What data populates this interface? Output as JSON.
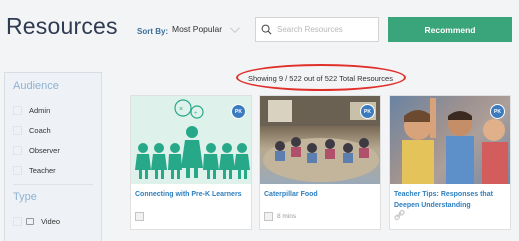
{
  "header": {
    "title": "Resources",
    "sort_label": "Sort By:",
    "sort_value": "Most Popular",
    "search_placeholder": "Search Resources",
    "recommend_label": "Recommend"
  },
  "sidebar": {
    "audience_heading": "Audience",
    "audience_items": [
      "Admin",
      "Coach",
      "Observer",
      "Teacher"
    ],
    "type_heading": "Type",
    "type_items": [
      "Video"
    ]
  },
  "results": {
    "count_text": "Showing 9 / 522 out of 522 Total Resources"
  },
  "cards": [
    {
      "badge": "PK",
      "title": "Connecting with Pre-K Learners",
      "meta": ""
    },
    {
      "badge": "PK",
      "title": "Caterpillar Food",
      "meta": "8 mins"
    },
    {
      "badge": "PK",
      "title": "Teacher Tips: Responses that Deepen Understanding",
      "meta": ""
    }
  ],
  "colors": {
    "accent_green": "#3aa57a",
    "link_blue": "#2d7fbf",
    "badge_blue": "#3b7bbf",
    "annotation_red": "#e0302b",
    "illustration_green": "#27a889"
  }
}
